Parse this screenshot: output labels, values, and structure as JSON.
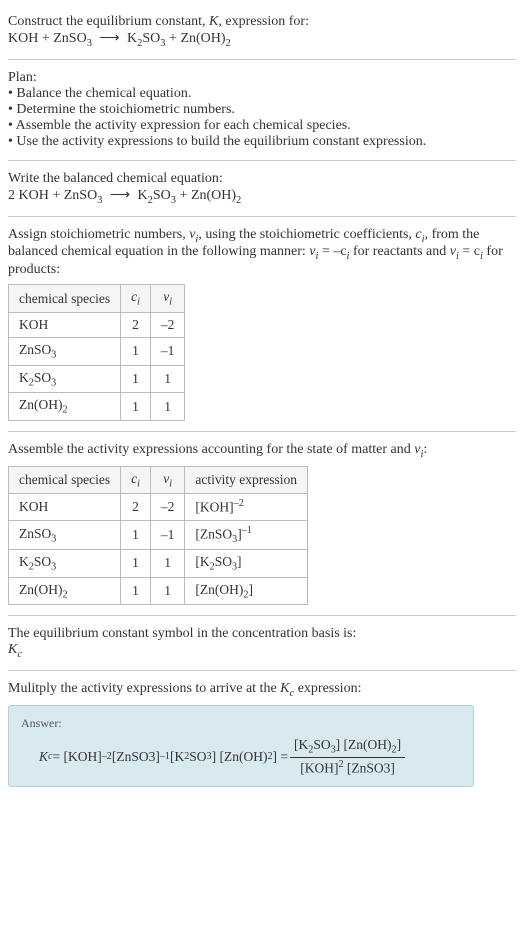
{
  "intro": {
    "line1": "Construct the equilibrium constant, ",
    "k": "K",
    "line1b": ", expression for:",
    "reaction_lhs": "KOH + ZnSO",
    "reaction_lhs_sub": "3",
    "arrow": "⟶",
    "reaction_rhs_a": "K",
    "reaction_rhs_a2": "2",
    "reaction_rhs_b": "SO",
    "reaction_rhs_b2": "3",
    "reaction_rhs_plus": " + Zn(OH)",
    "reaction_rhs_c": "2"
  },
  "plan": {
    "title": "Plan:",
    "b1": "• Balance the chemical equation.",
    "b2": "• Determine the stoichiometric numbers.",
    "b3": "• Assemble the activity expression for each chemical species.",
    "b4": "• Use the activity expressions to build the equilibrium constant expression."
  },
  "balanced": {
    "title": "Write the balanced chemical equation:",
    "lhs_coef": "2 KOH + ZnSO",
    "lhs_sub": "3",
    "arrow": "⟶",
    "rhs_a": "K",
    "rhs_a2": "2",
    "rhs_b": "SO",
    "rhs_b2": "3",
    "rhs_plus": " + Zn(OH)",
    "rhs_c": "2"
  },
  "stoich": {
    "text_a": "Assign stoichiometric numbers, ",
    "nu": "ν",
    "sub_i": "i",
    "text_b": ", using the stoichiometric coefficients, ",
    "c": "c",
    "text_c": ", from the balanced chemical equation in the following manner: ",
    "eq1_l": "ν",
    "eq1_r": " = –c",
    "text_d": " for reactants and ",
    "eq2": " = c",
    "text_e": " for products:",
    "headers": [
      "chemical species",
      "cᵢ",
      "νᵢ"
    ],
    "rows": [
      {
        "sp_a": "KOH",
        "sp_sub": "",
        "c": "2",
        "v": "–2"
      },
      {
        "sp_a": "ZnSO",
        "sp_sub": "3",
        "c": "1",
        "v": "–1"
      },
      {
        "sp_a": "K",
        "sp_mid": "2",
        "sp_b": "SO",
        "sp_sub": "3",
        "c": "1",
        "v": "1"
      },
      {
        "sp_a": "Zn(OH)",
        "sp_sub": "2",
        "c": "1",
        "v": "1"
      }
    ]
  },
  "activity": {
    "title_a": "Assemble the activity expressions accounting for the state of matter and ",
    "nu": "ν",
    "sub_i": "i",
    "title_b": ":",
    "headers": [
      "chemical species",
      "cᵢ",
      "νᵢ",
      "activity expression"
    ],
    "rows": [
      {
        "sp_a": "KOH",
        "sp_sub": "",
        "c": "2",
        "v": "–2",
        "act": "[KOH]",
        "act_sup": "–2"
      },
      {
        "sp_a": "ZnSO",
        "sp_sub": "3",
        "c": "1",
        "v": "–1",
        "act": "[ZnSO",
        "act_sub": "3",
        "act_close": "]",
        "act_sup": "–1"
      },
      {
        "sp_a": "K",
        "sp_mid": "2",
        "sp_b": "SO",
        "sp_sub": "3",
        "c": "1",
        "v": "1",
        "act": "[K",
        "act_sub1": "2",
        "act_mid": "SO",
        "act_sub2": "3",
        "act_close": "]",
        "act_sup": ""
      },
      {
        "sp_a": "Zn(OH)",
        "sp_sub": "2",
        "c": "1",
        "v": "1",
        "act": "[Zn(OH)",
        "act_sub": "2",
        "act_close": "]",
        "act_sup": ""
      }
    ]
  },
  "kc_symbol": {
    "line": "The equilibrium constant symbol in the concentration basis is:",
    "kc_k": "K",
    "kc_c": "c"
  },
  "multiply": {
    "line_a": "Mulitply the activity expressions to arrive at the ",
    "kc_k": "K",
    "kc_c": "c",
    "line_b": " expression:"
  },
  "answer": {
    "label": "Answer:",
    "kc_k": "K",
    "kc_c": "c",
    "eq": " = [KOH]",
    "sup1": "–2",
    "part2": " [ZnSO3]",
    "sup2": "–1",
    "part3": " [K",
    "s3a": "2",
    "part3b": "SO",
    "s3b": "3",
    "part3c": "] [Zn(OH)",
    "s3c": "2",
    "part3d": "] = ",
    "num_a": "[K",
    "num_a2": "2",
    "num_b": "SO",
    "num_b2": "3",
    "num_c": "] [Zn(OH)",
    "num_c2": "2",
    "num_d": "]",
    "den_a": "[KOH]",
    "den_a2": "2",
    "den_b": " [ZnSO3]"
  }
}
